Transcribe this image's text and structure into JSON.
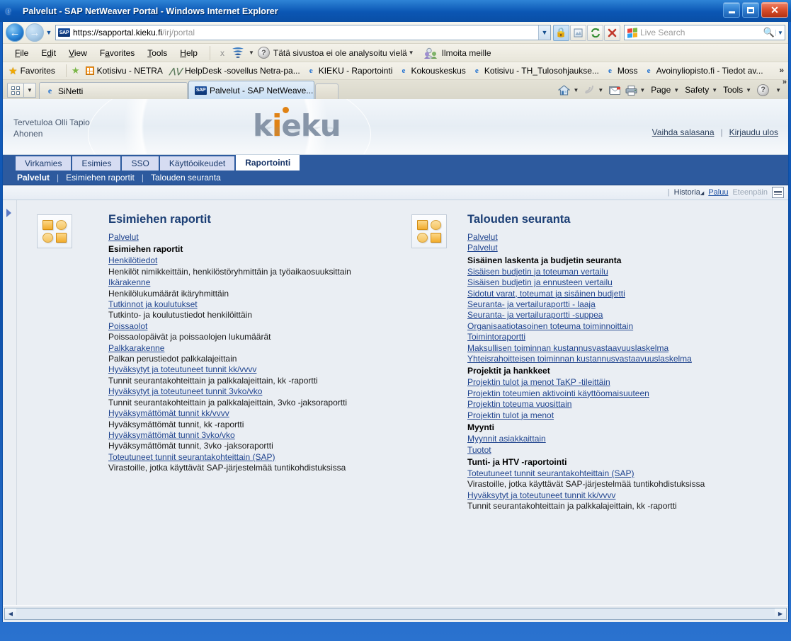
{
  "window": {
    "title": "Palvelut - SAP NetWeaver Portal - Windows Internet Explorer",
    "minimize_label": "Minimize",
    "maximize_label": "Maximize",
    "close_label": "Close"
  },
  "address_bar": {
    "url_scheme": "https://",
    "url_host": "sapportal.kieku.fi",
    "url_path": "/irj/portal",
    "url_full": "https://sapportal.kieku.fi/irj/portal",
    "dropdown_label": "▾",
    "buttons": [
      "lock-icon",
      "compatibility-icon",
      "refresh-icon",
      "stop-icon"
    ]
  },
  "search": {
    "placeholder": "Live Search",
    "value": ""
  },
  "menu": {
    "items": [
      "File",
      "Edit",
      "View",
      "Favorites",
      "Tools",
      "Help"
    ],
    "close_x": "x",
    "wot_label": "Tätä sivustoa ei ole analysoitu vielä",
    "report_label": "Ilmoita meille"
  },
  "favorites": {
    "label": "Favorites",
    "items": [
      {
        "icon": "netra-icon",
        "label": "Kotisivu - NETRA"
      },
      {
        "icon": "helpdesk-icon",
        "label": "HelpDesk -sovellus Netra-pa..."
      },
      {
        "icon": "ie-icon",
        "label": "KIEKU - Raportointi"
      },
      {
        "icon": "ie-icon",
        "label": "Kokouskeskus"
      },
      {
        "icon": "ie-icon",
        "label": "Kotisivu - TH_Tulosohjaukse..."
      },
      {
        "icon": "ie-icon",
        "label": "Moss"
      },
      {
        "icon": "ie-icon",
        "label": "Avoinyliopisto.fi - Tiedot av..."
      }
    ],
    "overflow": "»"
  },
  "tabs": {
    "items": [
      {
        "label": "SiNetti",
        "active": false,
        "icon": "ie-icon"
      },
      {
        "label": "Palvelut - SAP NetWeave...",
        "active": true,
        "icon": "sap-icon",
        "close": "✕"
      }
    ],
    "new_tab_label": ""
  },
  "browser_toolbar_right": {
    "home": "Home",
    "feeds": "Feeds",
    "read_mail": "Read mail",
    "print": "Print",
    "page": "Page",
    "safety": "Safety",
    "tools": "Tools",
    "help": "Help",
    "overflow": "»"
  },
  "portal": {
    "welcome_line1": "Tervetuloa Olli Tapio",
    "welcome_line2": "Ahonen",
    "logo": "kieku",
    "header_links": [
      {
        "label": "Vaihda salasana",
        "name": "change-password-link"
      },
      {
        "label": "Kirjaudu ulos",
        "name": "logout-link"
      }
    ],
    "nav_level1": [
      {
        "label": "Virkamies",
        "selected": false
      },
      {
        "label": "Esimies",
        "selected": false
      },
      {
        "label": "SSO",
        "selected": false
      },
      {
        "label": "Käyttöoikeudet",
        "selected": false
      },
      {
        "label": "Raportointi",
        "selected": true
      }
    ],
    "nav_level2": [
      {
        "label": "Palvelut",
        "selected": true
      },
      {
        "label": "Esimiehen raportit",
        "selected": false
      },
      {
        "label": "Talouden seuranta",
        "selected": false
      }
    ],
    "toolbar": {
      "history": "Historia",
      "back": "Paluu",
      "forward": "Eteenpäin",
      "menu_icon": "list-menu-icon"
    }
  },
  "columns": [
    {
      "title": "Esimiehen raportit",
      "icon": "four-squares-icon",
      "rows": [
        {
          "type": "link",
          "text": "Palvelut"
        },
        {
          "type": "header",
          "text": "Esimiehen raportit"
        },
        {
          "type": "link",
          "text": "Henkilötiedot"
        },
        {
          "type": "desc",
          "text": "Henkilöt nimikkeittäin, henkilöstöryhmittäin ja työaikaosuuksittain"
        },
        {
          "type": "link",
          "text": "Ikärakenne"
        },
        {
          "type": "desc",
          "text": "Henkilölukumäärät ikäryhmittäin"
        },
        {
          "type": "link",
          "text": "Tutkinnot ja koulutukset"
        },
        {
          "type": "desc",
          "text": "Tutkinto- ja koulutustiedot henkilöittäin"
        },
        {
          "type": "link",
          "text": "Poissaolot"
        },
        {
          "type": "desc",
          "text": "Poissaolopäivät ja poissaolojen lukumäärät"
        },
        {
          "type": "link",
          "text": "Palkkarakenne"
        },
        {
          "type": "desc",
          "text": "Palkan perustiedot palkkalajeittain"
        },
        {
          "type": "link",
          "text": "Hyväksytyt ja toteutuneet tunnit kk/vvvv"
        },
        {
          "type": "desc",
          "text": "Tunnit seurantakohteittain ja palkkalajeittain, kk -raportti"
        },
        {
          "type": "link",
          "text": "Hyväksytyt ja toteutuneet tunnit 3vko/vko"
        },
        {
          "type": "desc",
          "text": "Tunnit seurantakohteittain ja palkkalajeittain, 3vko -jaksoraportti"
        },
        {
          "type": "link",
          "text": "Hyväksymättömät tunnit kk/vvvv"
        },
        {
          "type": "desc",
          "text": "Hyväksymättömät tunnit, kk -raportti"
        },
        {
          "type": "link",
          "text": "Hyväksymättömät tunnit 3vko/vko"
        },
        {
          "type": "desc",
          "text": "Hyväksymättömät tunnit, 3vko -jaksoraportti"
        },
        {
          "type": "link",
          "text": "Toteutuneet tunnit seurantakohteittain (SAP)"
        },
        {
          "type": "desc",
          "text": "Virastoille, jotka käyttävät SAP-järjestelmää tuntikohdistuksissa"
        }
      ]
    },
    {
      "title": "Talouden seuranta",
      "icon": "four-squares-icon",
      "rows": [
        {
          "type": "link",
          "text": "Palvelut"
        },
        {
          "type": "link",
          "text": "Palvelut"
        },
        {
          "type": "header",
          "text": "Sisäinen laskenta ja budjetin seuranta"
        },
        {
          "type": "link",
          "text": "Sisäisen budjetin ja toteuman vertailu"
        },
        {
          "type": "link",
          "text": "Sisäisen budjetin ja ennusteen vertailu"
        },
        {
          "type": "link",
          "text": "Sidotut varat, toteumat ja sisäinen budjetti"
        },
        {
          "type": "link",
          "text": "Seuranta- ja vertailuraportti - laaja"
        },
        {
          "type": "link",
          "text": "Seuranta- ja vertailuraportti -suppea"
        },
        {
          "type": "link",
          "text": "Organisaatiotasoinen toteuma toiminnoittain"
        },
        {
          "type": "link",
          "text": "Toimintoraportti"
        },
        {
          "type": "link",
          "text": "Maksullisen toiminnan kustannusvastaavuuslaskelma"
        },
        {
          "type": "link",
          "text": "Yhteisrahoitteisen toiminnan kustannusvastaavuuslaskelma"
        },
        {
          "type": "header",
          "text": "Projektit ja hankkeet"
        },
        {
          "type": "link",
          "text": "Projektin tulot ja menot TaKP -tileittäin"
        },
        {
          "type": "link",
          "text": "Projektin toteumien aktivointi käyttöomaisuuteen"
        },
        {
          "type": "link",
          "text": "Projektin toteuma vuosittain"
        },
        {
          "type": "link",
          "text": "Projektin tulot ja menot"
        },
        {
          "type": "header",
          "text": "Myynti"
        },
        {
          "type": "link",
          "text": "Myynnit asiakkaittain"
        },
        {
          "type": "link",
          "text": "Tuotot"
        },
        {
          "type": "header",
          "text": "Tunti- ja HTV -raportointi"
        },
        {
          "type": "link",
          "text": "Toteutuneet tunnit seurantakohteittain (SAP)"
        },
        {
          "type": "desc",
          "text": "Virastoille, jotka käyttävät SAP-järjestelmää tuntikohdistuksissa"
        },
        {
          "type": "link",
          "text": "Hyväksytyt ja toteutuneet tunnit kk/vvvv"
        },
        {
          "type": "desc",
          "text": "Tunnit seurantakohteittain ja palkkalajeittain, kk -raportti"
        }
      ]
    }
  ],
  "colors": {
    "titlebar_blue": "#0b56b4",
    "portal_nav_blue": "#2d5a9e",
    "link_blue": "#21458f",
    "heading_blue": "#1c3f75",
    "accent_orange": "#e08214",
    "page_bg": "#eaeef3"
  }
}
